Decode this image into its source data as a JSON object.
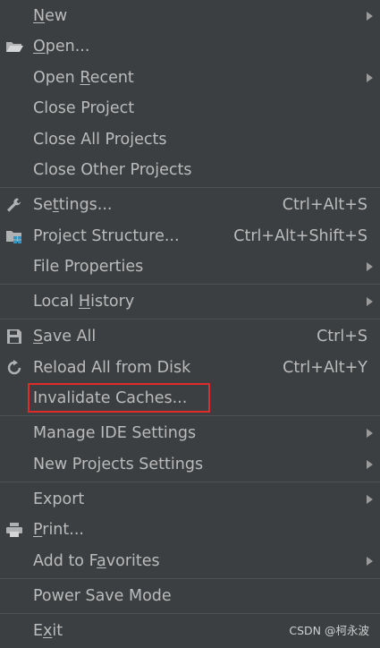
{
  "menu": {
    "new": {
      "pre": "",
      "mn": "N",
      "post": "ew"
    },
    "open": {
      "pre": "",
      "mn": "O",
      "post": "pen..."
    },
    "open_recent": {
      "pre": "Open ",
      "mn": "R",
      "post": "ecent"
    },
    "close_project": {
      "label": "Close Project"
    },
    "close_all_projects": {
      "label": "Close All Projects"
    },
    "close_other_projects": {
      "label": "Close Other Projects"
    },
    "settings": {
      "pre": "Se",
      "mn": "t",
      "post": "tings...",
      "shortcut": "Ctrl+Alt+S"
    },
    "project_structure": {
      "label": "Project Structure...",
      "shortcut": "Ctrl+Alt+Shift+S"
    },
    "file_properties": {
      "label": "File Properties"
    },
    "local_history": {
      "pre": "Local ",
      "mn": "H",
      "post": "istory"
    },
    "save_all": {
      "pre": "",
      "mn": "S",
      "post": "ave All",
      "shortcut": "Ctrl+S"
    },
    "reload_all": {
      "label": "Reload All from Disk",
      "shortcut": "Ctrl+Alt+Y"
    },
    "invalidate_caches": {
      "label": "Invalidate Caches..."
    },
    "manage_ide_settings": {
      "label": "Manage IDE Settings"
    },
    "new_projects_settings": {
      "label": "New Projects Settings"
    },
    "export": {
      "label": "Export"
    },
    "print": {
      "pre": "",
      "mn": "P",
      "post": "rint..."
    },
    "add_to_favorites": {
      "pre": "Add to F",
      "mn": "a",
      "post": "vorites"
    },
    "power_save_mode": {
      "label": "Power Save Mode"
    },
    "exit": {
      "pre": "E",
      "mn": "x",
      "post": "it"
    }
  },
  "watermark": "CSDN @柯永波",
  "colors": {
    "background": "#3c3f41",
    "text": "#bbbbbb",
    "separator": "#515151",
    "highlight_border": "#e02b2b",
    "folder_icon": "#afb1b3",
    "structure_icon_blue": "#3592c4"
  },
  "icons": {
    "open": "folder-icon",
    "settings": "wrench-icon",
    "project_structure": "project-structure-icon",
    "save_all": "save-icon",
    "reload_all": "reload-icon",
    "print": "printer-icon"
  }
}
